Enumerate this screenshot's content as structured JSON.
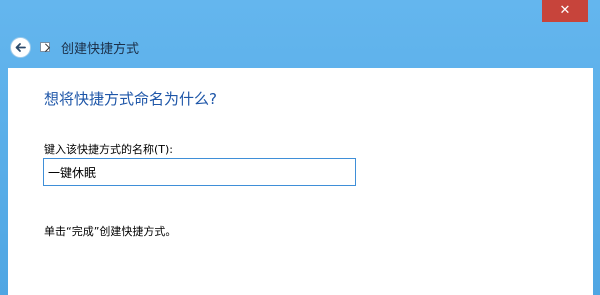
{
  "window": {
    "title": "创建快捷方式",
    "close_glyph": "✕",
    "accent_color": "#5aaee8"
  },
  "icons": {
    "back": "back-arrow-icon",
    "shortcut": "shortcut-icon"
  },
  "main": {
    "heading": "想将快捷方式命名为什么?",
    "field_label": "键入该快捷方式的名称(T):",
    "name_value": "一键休眠",
    "hint": "单击“完成”创建快捷方式。"
  }
}
